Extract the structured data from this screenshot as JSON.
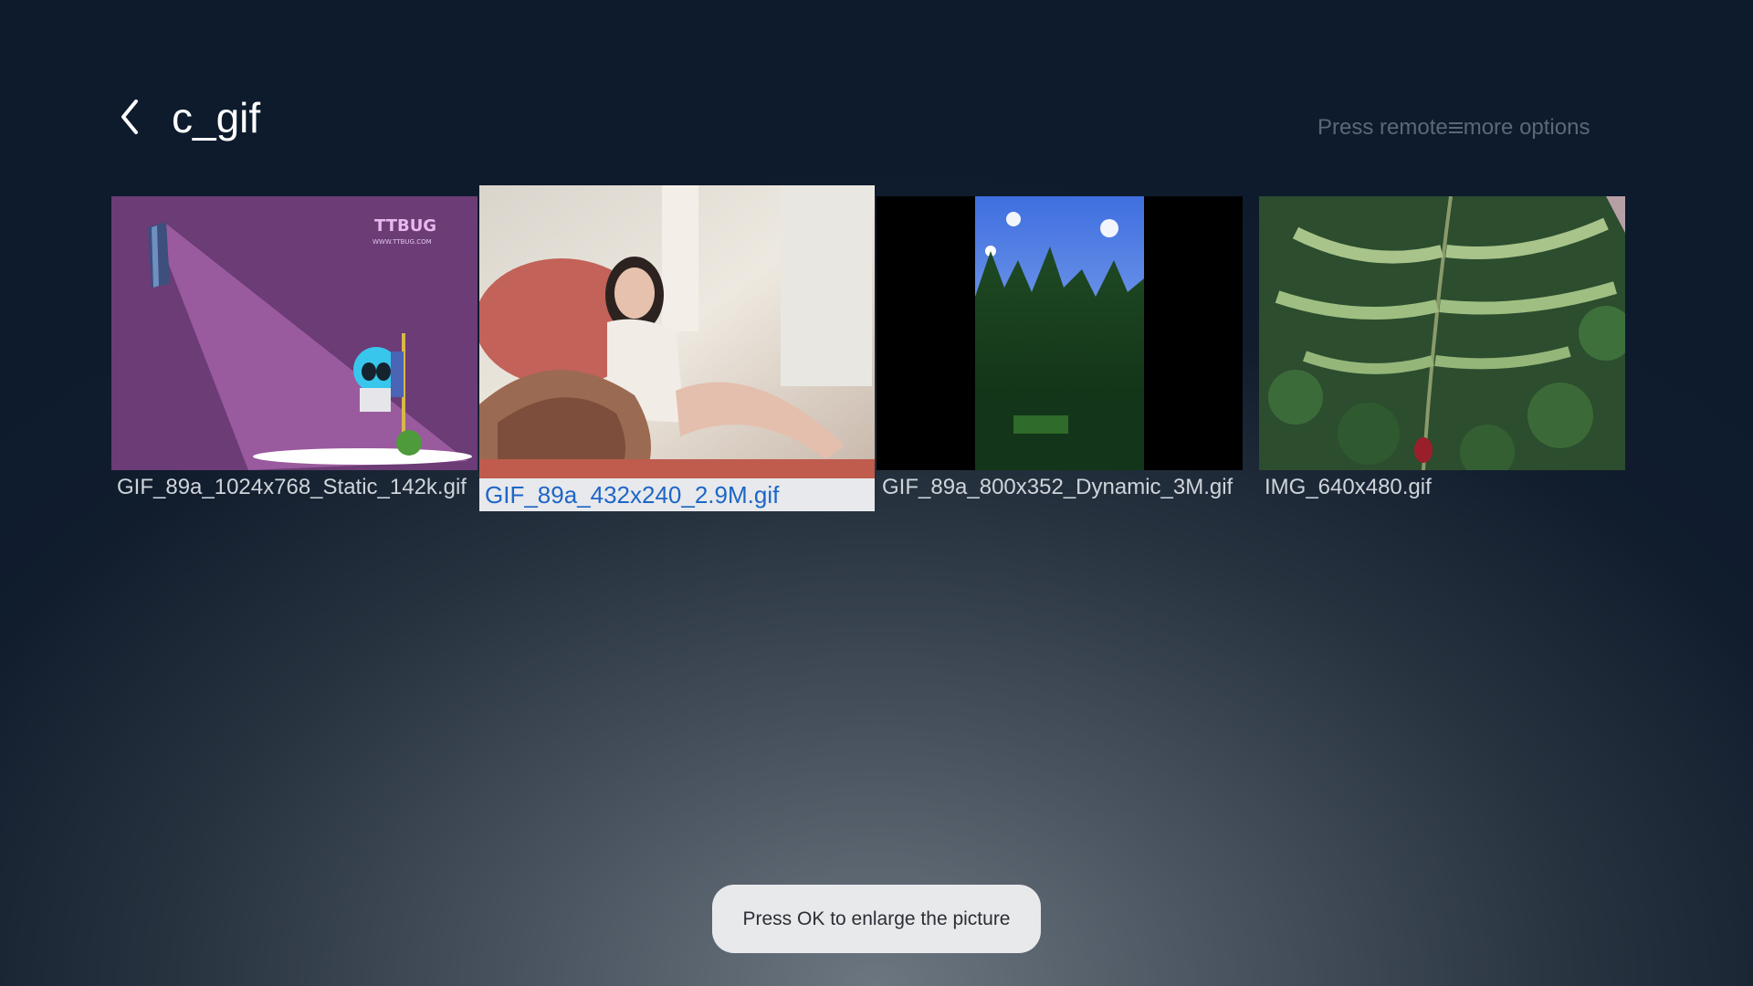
{
  "header": {
    "title": "c_gif",
    "hint_before": "Press remote",
    "hint_after": "more options"
  },
  "files": [
    {
      "name": "GIF_89a_1024x768_Static_142k.gif",
      "focused": false,
      "thumb_watermark": "TTBUG",
      "thumb_watermark_sub": "WWW.TTBUG.COM"
    },
    {
      "name": "GIF_89a_432x240_2.9M.gif",
      "focused": true
    },
    {
      "name": "GIF_89a_800x352_Dynamic_3M.gif",
      "focused": false
    },
    {
      "name": "IMG_640x480.gif",
      "focused": false
    }
  ],
  "toast": {
    "text": "Press OK to enlarge the picture"
  },
  "colors": {
    "focus_label_bg": "#e7e9ec",
    "focus_label_text": "#1d66c7",
    "hint_text": "#5c6875"
  }
}
